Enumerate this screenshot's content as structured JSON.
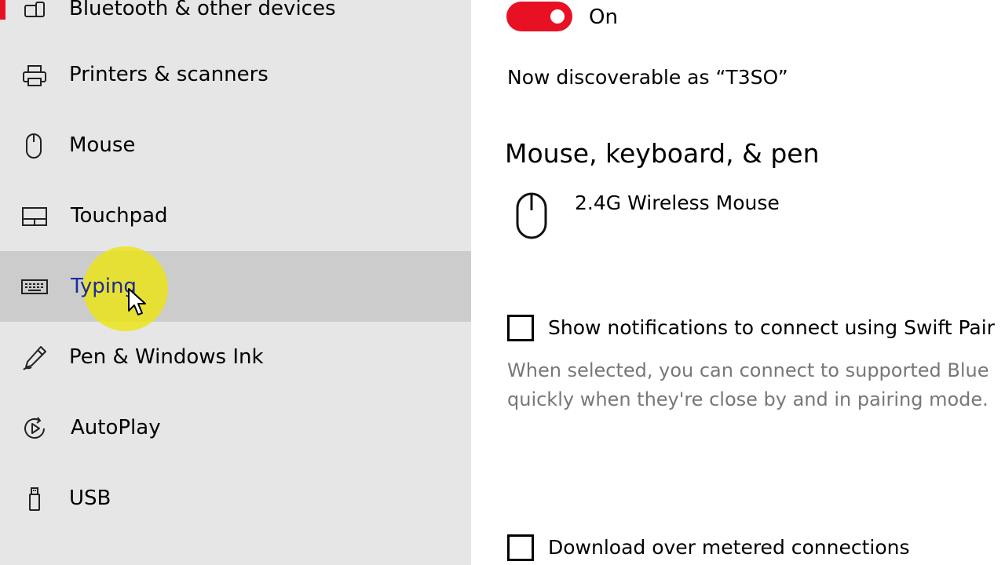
{
  "colors": {
    "accent": "#e81123",
    "sidebar_bg": "#e6e6e6",
    "sidebar_selected_bg": "#cccccc",
    "cursor_highlight": "#ebe414",
    "secondary_text": "#777777"
  },
  "sidebar": {
    "items": [
      {
        "label": "Bluetooth & other devices",
        "icon": "bluetooth-devices-icon"
      },
      {
        "label": "Printers & scanners",
        "icon": "printer-icon"
      },
      {
        "label": "Mouse",
        "icon": "mouse-icon"
      },
      {
        "label": "Touchpad",
        "icon": "touchpad-icon"
      },
      {
        "label": "Typing",
        "icon": "keyboard-icon"
      },
      {
        "label": "Pen & Windows Ink",
        "icon": "pen-icon"
      },
      {
        "label": "AutoPlay",
        "icon": "autoplay-icon"
      },
      {
        "label": "USB",
        "icon": "usb-icon"
      }
    ]
  },
  "main": {
    "bluetooth_toggle": {
      "state_label": "On",
      "on": true
    },
    "discoverable_text": "Now discoverable as “T3SO”",
    "section_heading": "Mouse, keyboard, & pen",
    "devices": [
      {
        "name": "2.4G Wireless Mouse",
        "icon": "mouse-icon"
      }
    ],
    "swift_pair": {
      "label": "Show notifications to connect using Swift Pair",
      "checked": false,
      "description_line1": "When selected, you can connect to supported Blue",
      "description_line2": "quickly when they're close by and in pairing mode."
    },
    "metered": {
      "label": "Download over metered connections",
      "checked": false
    }
  }
}
